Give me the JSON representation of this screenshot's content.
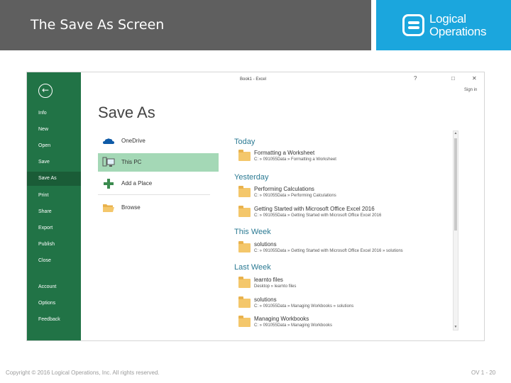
{
  "slide": {
    "title": "The Save As Screen",
    "logo_line1": "Logical",
    "logo_line2": "Operations",
    "copyright": "Copyright © 2016 Logical Operations, Inc. All rights reserved.",
    "page_number": "OV 1 - 20"
  },
  "excel": {
    "window_title": "Book1 - Excel",
    "help": "?",
    "restore": "□",
    "close": "✕",
    "sign_in": "Sign in",
    "page_heading": "Save As",
    "back_icon": "arrow-left-icon",
    "nav": [
      {
        "label": "Info"
      },
      {
        "label": "New"
      },
      {
        "label": "Open"
      },
      {
        "label": "Save"
      },
      {
        "label": "Save As",
        "active": true
      },
      {
        "label": "Print"
      },
      {
        "label": "Share"
      },
      {
        "label": "Export"
      },
      {
        "label": "Publish"
      },
      {
        "label": "Close"
      },
      {
        "label": "Account"
      },
      {
        "label": "Options"
      },
      {
        "label": "Feedback"
      }
    ],
    "locations": [
      {
        "label": "OneDrive",
        "icon": "cloud-icon"
      },
      {
        "label": "This PC",
        "icon": "computer-icon",
        "selected": true
      },
      {
        "label": "Add a Place",
        "icon": "plus-icon"
      },
      {
        "label": "Browse",
        "icon": "folder-open-icon"
      }
    ],
    "sections": [
      {
        "heading": "Today",
        "items": [
          {
            "name": "Formatting a Worksheet",
            "path": "C: » 091055Data » Formatting a Worksheet"
          }
        ]
      },
      {
        "heading": "Yesterday",
        "items": [
          {
            "name": "Performing Calculations",
            "path": "C: » 091055Data » Performing Calculations"
          },
          {
            "name": "Getting Started with Microsoft Office Excel 2016",
            "path": "C: » 091055Data » Getting Started with Microsoft Office Excel 2016"
          }
        ]
      },
      {
        "heading": "This Week",
        "items": [
          {
            "name": "solutions",
            "path": "C: » 091055Data » Getting Started with Microsoft Office Excel 2016 » solutions"
          }
        ]
      },
      {
        "heading": "Last Week",
        "items": [
          {
            "name": "learnto files",
            "path": "Desktop » learnto files"
          },
          {
            "name": "solutions",
            "path": "C: » 091055Data » Managing Workbooks » solutions"
          },
          {
            "name": "Managing Workbooks",
            "path": "C: » 091055Data » Managing Workbooks"
          }
        ]
      }
    ],
    "colors": {
      "nav_green": "#217346",
      "selected_green": "#a4d8b6",
      "section_blue": "#2b7a93",
      "header_gray": "#5f5f5f",
      "logo_blue": "#1ba6dd"
    }
  }
}
